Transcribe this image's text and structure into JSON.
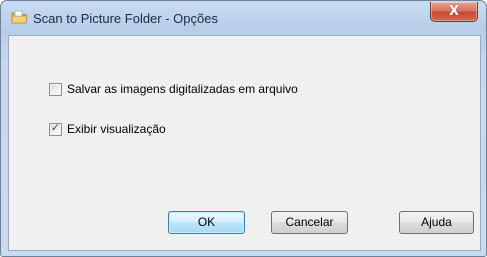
{
  "window": {
    "title": "Scan to Picture Folder - Opções",
    "close_glyph": "X",
    "close_icon": "close-icon",
    "app_icon": "folder-scan-icon"
  },
  "options": [
    {
      "label": "Salvar as imagens digitalizadas em arquivo",
      "checked": false
    },
    {
      "label": "Exibir visualização",
      "checked": true
    }
  ],
  "buttons": {
    "ok_label": "OK",
    "cancel_label": "Cancelar",
    "help_label": "Ajuda"
  },
  "check_glyph": "✓"
}
